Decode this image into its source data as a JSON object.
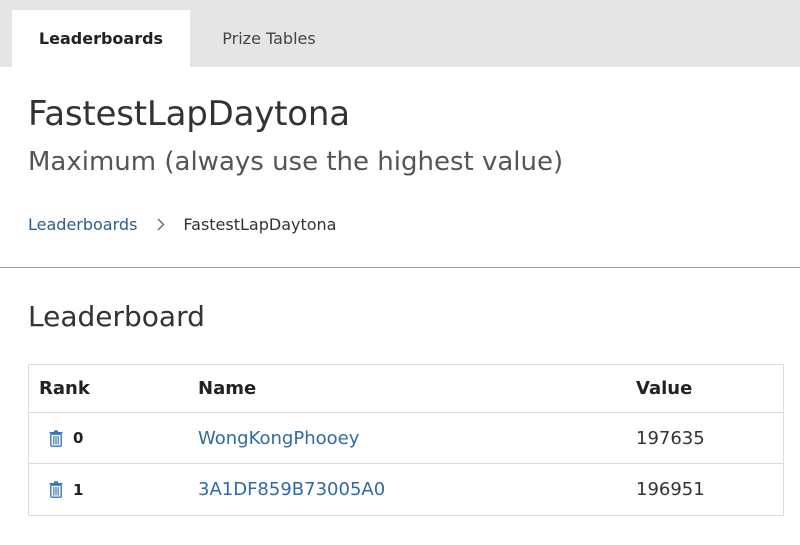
{
  "tabs": [
    {
      "label": "Leaderboards",
      "active": true
    },
    {
      "label": "Prize Tables",
      "active": false
    }
  ],
  "header": {
    "title": "FastestLapDaytona",
    "subtitle": "Maximum (always use the highest value)"
  },
  "breadcrumb": {
    "root": "Leaderboards",
    "current": "FastestLapDaytona"
  },
  "section": {
    "title": "Leaderboard"
  },
  "table": {
    "columns": [
      "Rank",
      "Name",
      "Value"
    ],
    "rows": [
      {
        "rank": "0",
        "name": "WongKongPhooey",
        "value": "197635"
      },
      {
        "rank": "1",
        "name": "3A1DF859B73005A0",
        "value": "196951"
      }
    ]
  },
  "colors": {
    "tab_bar": "#e5e5e5",
    "link": "#2e6aa8",
    "delete_icon": "#3a78b5"
  },
  "icons": {
    "row_action": "trash-icon",
    "breadcrumb_separator": "chevron-right-icon"
  }
}
